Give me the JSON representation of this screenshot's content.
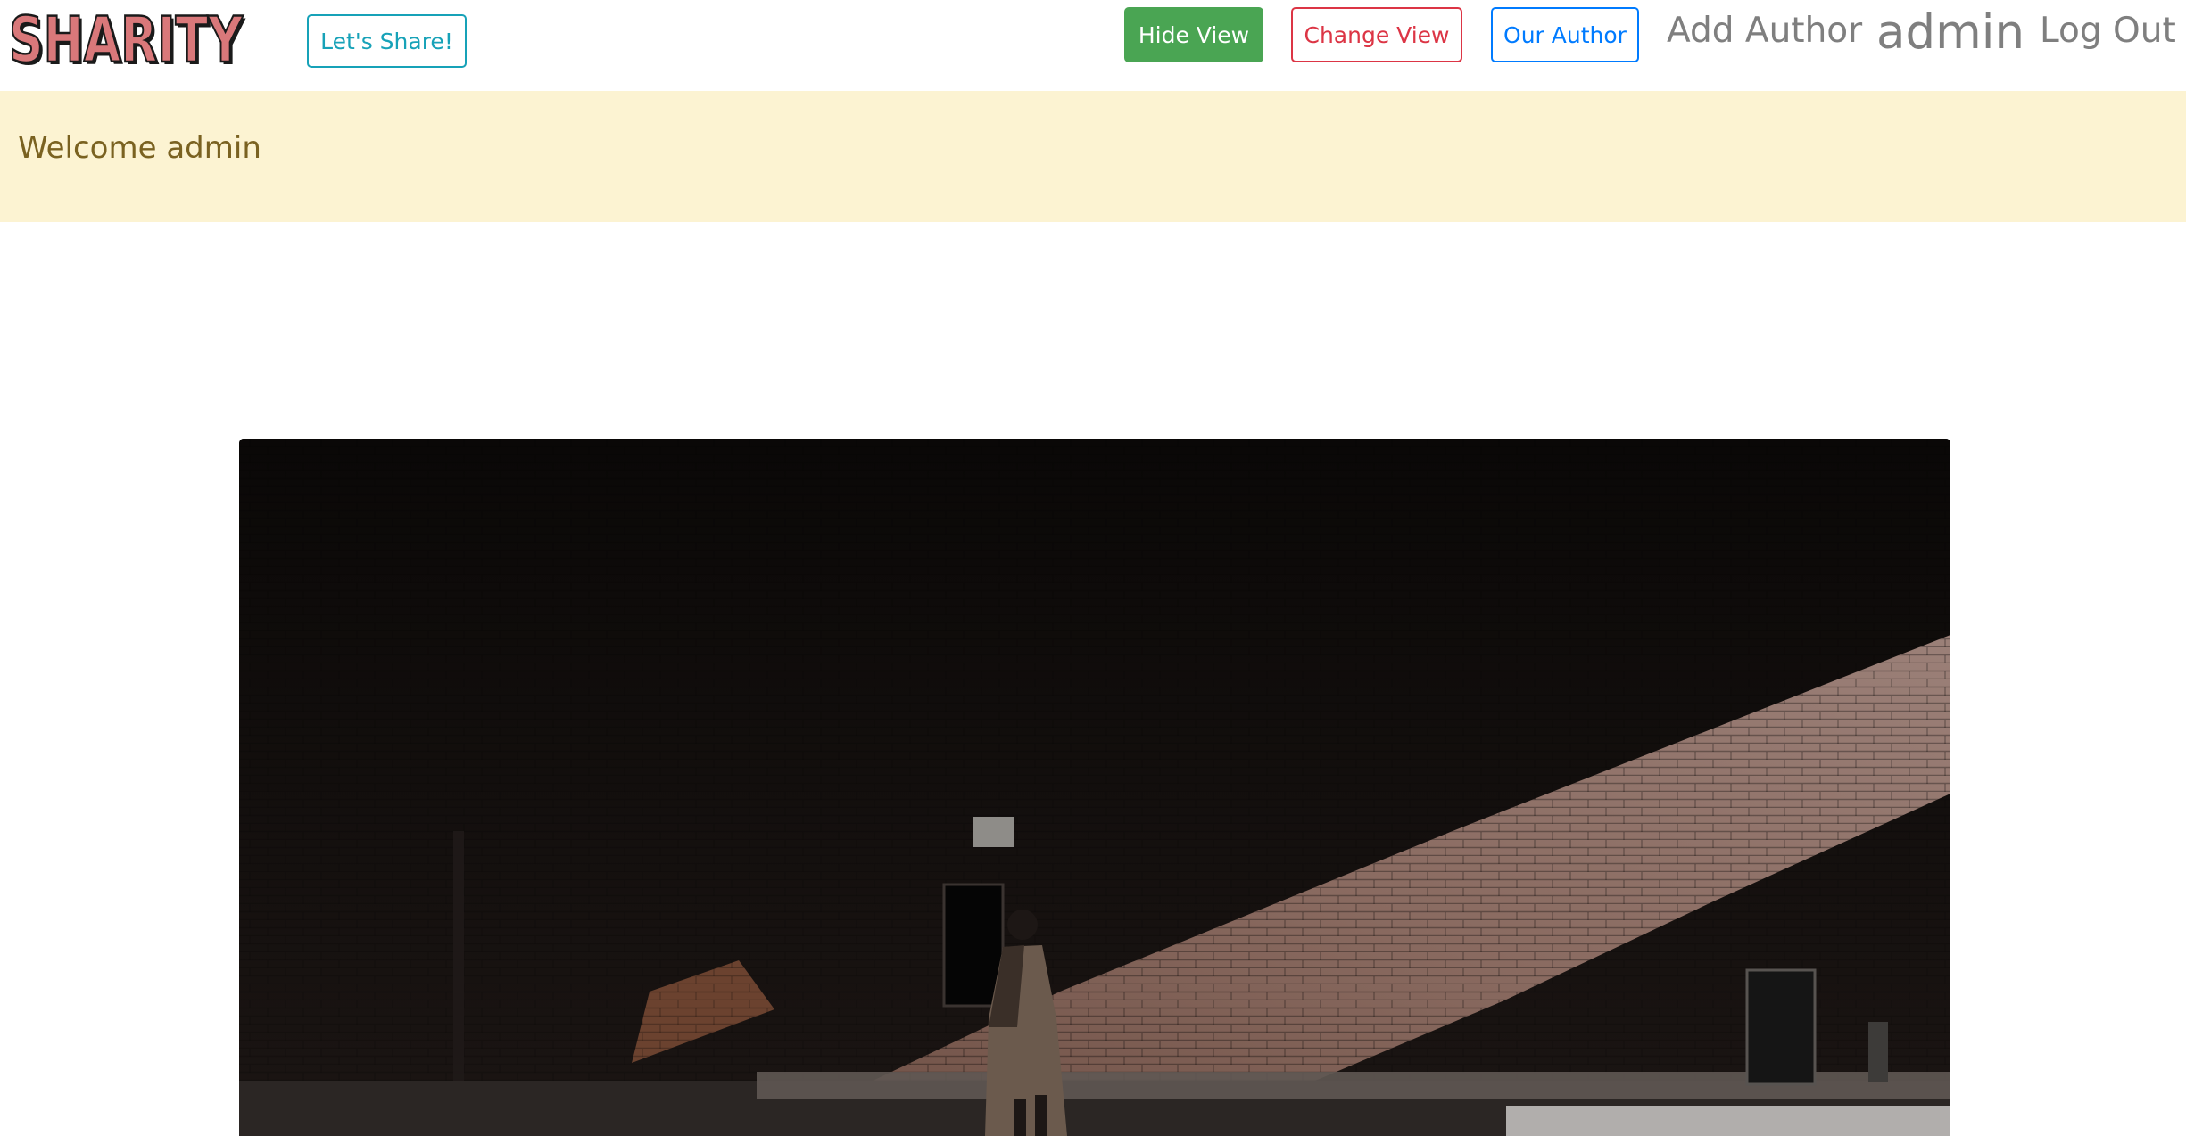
{
  "brand": {
    "logo_text": "SHARITY"
  },
  "navbar": {
    "share_label": "Let's Share!",
    "hide_view_label": "Hide View",
    "change_view_label": "Change View",
    "our_author_label": "Our Author",
    "add_author_label": "Add Author",
    "user_label": "admin",
    "logout_label": "Log Out"
  },
  "alert": {
    "message": "Welcome admin"
  },
  "hero": {
    "alt": "Person walking past a sunlit brick wall"
  },
  "colors": {
    "hide_view": "#4aa553",
    "change_view": "#dc3545",
    "our_author": "#007bff",
    "share": "#17a2b8",
    "alert_bg": "#fcf3d2",
    "alert_text": "#7a6221"
  }
}
